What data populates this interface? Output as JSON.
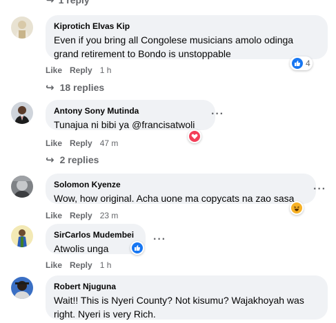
{
  "thread_top": {
    "replies_label": "1 reply"
  },
  "comments": [
    {
      "author": "Kiprotich Elvas Kip",
      "text": "Even if you bring all Congolese musicians amolo odinga grand retirement to Bondo is unstoppable",
      "like": "Like",
      "reply": "Reply",
      "time": "1 h",
      "reaction": "like-icon",
      "reaction_count": "4",
      "replies_label": "18 replies"
    },
    {
      "author": "Antony Sony Mutinda",
      "text": "Tunajua ni bibi ya @francisatwoli",
      "like": "Like",
      "reply": "Reply",
      "time": "47 m",
      "reaction": "love-icon",
      "replies_label": "2 replies"
    },
    {
      "author": "Solomon Kyenze",
      "text": "Wow, how original. Acha uone ma copycats na zao sasa",
      "like": "Like",
      "reply": "Reply",
      "time": "23 m",
      "reaction": "haha-icon"
    },
    {
      "author": "SirCarlos Mudembei",
      "text": "Atwolis unga",
      "like": "Like",
      "reply": "Reply",
      "time": "1 h",
      "reaction": "like-icon"
    },
    {
      "author": "Robert Njuguna",
      "text": "Wait!! This is Nyeri County? Not kisumu? Wajakhoyah was right. Nyeri is very Rich."
    }
  ],
  "colors": {
    "bubble": "#f0f2f5",
    "muted": "#65676b",
    "like": "#1877f2",
    "love": "#f33e58",
    "haha": "#f7b125"
  }
}
